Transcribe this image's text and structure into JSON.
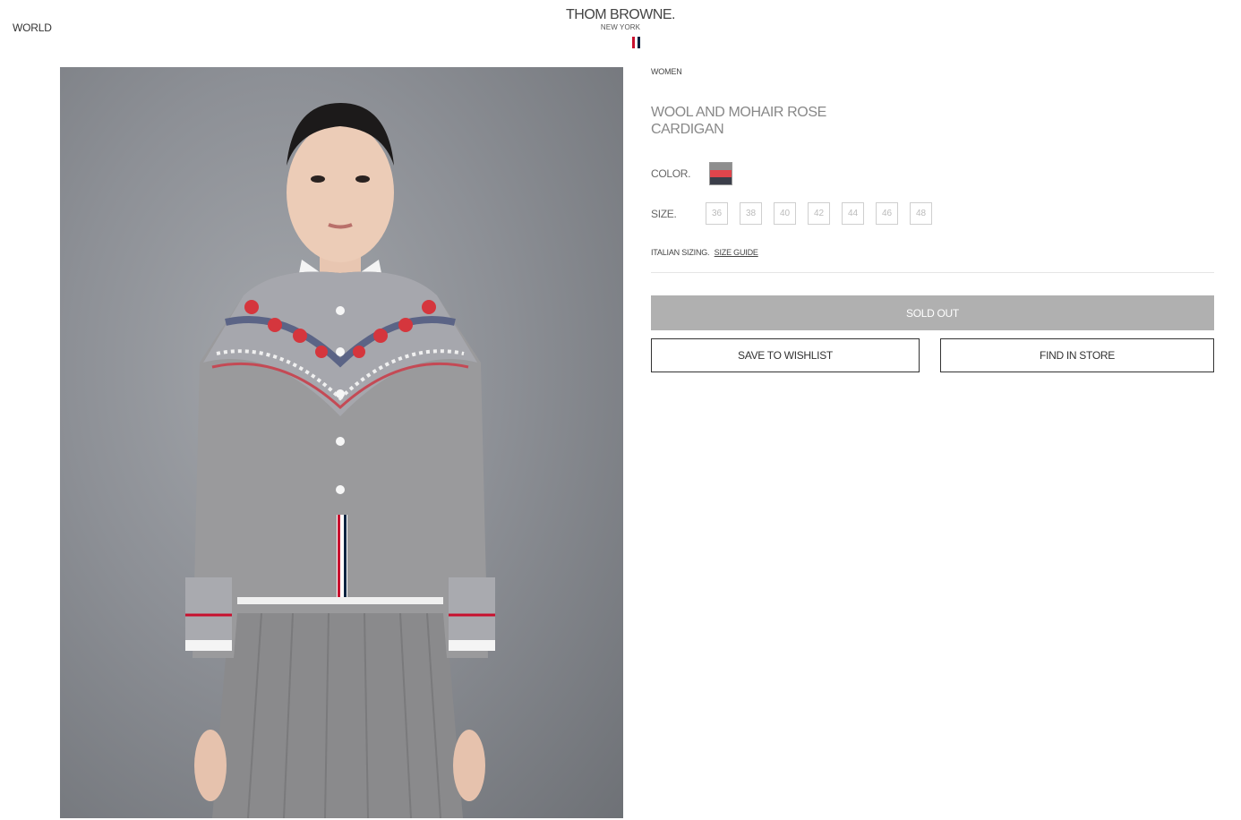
{
  "header": {
    "region_label": "WORLD",
    "brand_name": "THOM BROWNE.",
    "brand_city": "NEW YORK",
    "flag_colors": [
      "#c8102e",
      "#ffffff",
      "#0c2340"
    ]
  },
  "product": {
    "category": "WOMEN",
    "title_line1": "WOOL AND MOHAIR ROSE",
    "title_line2": "CARDIGAN",
    "color_label": "COLOR.",
    "swatch_colors": [
      "#8e8e8e",
      "#e0454c",
      "#3b3e4a"
    ],
    "size_label": "SIZE.",
    "sizes": [
      "36",
      "38",
      "40",
      "42",
      "44",
      "46",
      "48"
    ],
    "sizing_note": "ITALIAN SIZING.",
    "size_guide_link": "SIZE GUIDE",
    "sold_out_label": "SOLD OUT",
    "wishlist_label": "SAVE TO WISHLIST",
    "find_store_label": "FIND IN STORE"
  },
  "colors": {
    "sold_out_bg": "#b0b0b0",
    "image_bg": "#8d9096"
  }
}
